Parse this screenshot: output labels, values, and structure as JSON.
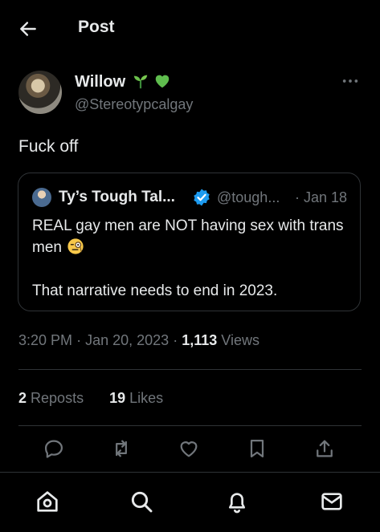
{
  "header": {
    "title": "Post"
  },
  "author": {
    "name": "Willow",
    "handle": "@Stereotypcalgay",
    "emojis": [
      "seedling-emoji",
      "green-heart-emoji"
    ]
  },
  "post": {
    "text": "Fuck off"
  },
  "quote": {
    "name": "Ty’s Tough Tal...",
    "handle": "@tough...",
    "date": "· Jan 18",
    "text_line1": "REAL gay men are NOT having sex with trans men",
    "text_line2": "That narrative needs to end in 2023.",
    "verified": true
  },
  "meta": {
    "time": "3:20 PM",
    "date": "Jan 20, 2023",
    "views_count": "1,113",
    "views_label": "Views",
    "sep": "·"
  },
  "stats": {
    "reposts_count": "2",
    "reposts_label": "Reposts",
    "likes_count": "19",
    "likes_label": "Likes"
  },
  "actions": [
    "reply-icon",
    "repost-icon",
    "like-icon",
    "bookmark-icon",
    "share-icon"
  ],
  "nav": [
    "home-icon",
    "search-icon",
    "notifications-icon",
    "messages-icon"
  ],
  "colors": {
    "background": "#000000",
    "text": "#e7e9ea",
    "muted": "#71767b",
    "border": "#2f3336",
    "verified": "#1d9bf0"
  }
}
